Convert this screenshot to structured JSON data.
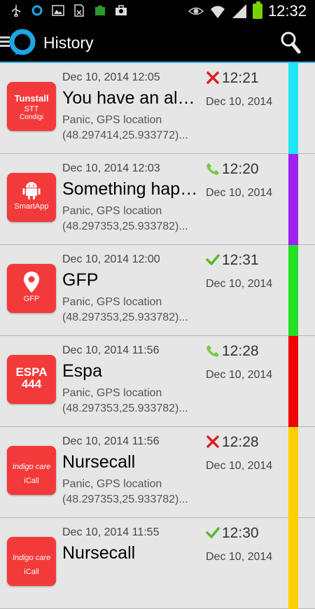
{
  "statusbar": {
    "icons": [
      "usb-icon",
      "app-notification-icon",
      "image-icon",
      "file-icon",
      "battery-app-icon",
      "briefcase-icon"
    ],
    "right_icons": [
      "eye-icon",
      "wifi-icon",
      "signal-icon",
      "battery-icon"
    ],
    "time": "12:32"
  },
  "actionbar": {
    "title": "History",
    "accent": "#33b5e5"
  },
  "items": [
    {
      "when": "Dec 10, 2014 12:05",
      "name": "You have an alarm",
      "type": "Panic,  GPS location",
      "location": "(48.297414,25.933772)...",
      "status": "rejected",
      "status_icon": "cross-icon",
      "time": "12:21",
      "date": "Dec 10, 2014",
      "color": "#20e6f5",
      "logo": {
        "kind": "tunstall",
        "lines": [
          "Tunstall",
          "STT",
          "Condigi"
        ]
      }
    },
    {
      "when": "Dec 10, 2014 12:03",
      "name": "Something happened",
      "type": "Panic,  GPS location",
      "location": "(48.297353,25.933782)...",
      "status": "called",
      "status_icon": "phone-icon",
      "time": "12:20",
      "date": "Dec 10, 2014",
      "color": "#a020f0",
      "logo": {
        "kind": "android",
        "lines": [
          "SmartApp"
        ]
      }
    },
    {
      "when": "Dec 10, 2014 12:00",
      "name": "GFP",
      "type": "Panic,  GPS location",
      "location": "(48.297353,25.933782)...",
      "status": "accepted",
      "status_icon": "check-icon",
      "time": "12:31",
      "date": "Dec 10, 2014",
      "color": "#22e022",
      "logo": {
        "kind": "pin",
        "lines": [
          "GFP"
        ]
      }
    },
    {
      "when": "Dec 10, 2014 11:56",
      "name": "Espa",
      "type": "Panic,  GPS location",
      "location": "(48.297353,25.933782)...",
      "status": "called",
      "status_icon": "phone-icon",
      "time": "12:28",
      "date": "Dec 10, 2014",
      "color": "#f00000",
      "logo": {
        "kind": "espa",
        "lines": [
          "ESPA",
          "444"
        ]
      }
    },
    {
      "when": "Dec 10, 2014 11:56",
      "name": "Nursecall",
      "type": "Panic,  GPS location",
      "location": "(48.297353,25.933782)...",
      "status": "rejected",
      "status_icon": "cross-icon",
      "time": "12:28",
      "date": "Dec 10, 2014",
      "color": "#ffd000",
      "logo": {
        "kind": "indigo",
        "lines": [
          "Indigo care",
          "iCall"
        ]
      }
    },
    {
      "when": "Dec 10, 2014 11:55",
      "name": "Nursecall",
      "type": "",
      "location": "",
      "status": "accepted",
      "status_icon": "check-icon",
      "time": "12:30",
      "date": "Dec 10, 2014",
      "color": "#ffd000",
      "logo": {
        "kind": "indigo",
        "lines": [
          "Indigo care",
          "iCall"
        ]
      }
    }
  ]
}
